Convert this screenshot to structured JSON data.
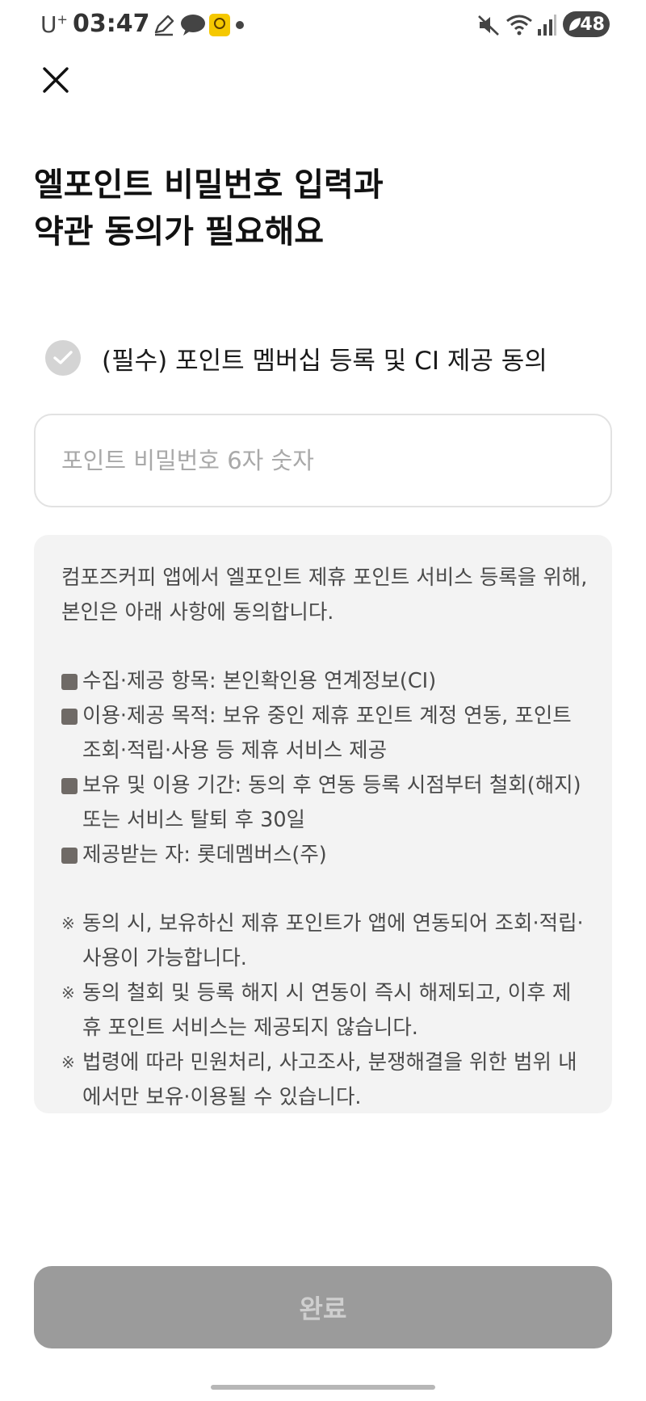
{
  "status_bar": {
    "carrier": "U",
    "carrier_sup": "+",
    "time": "03:47",
    "battery": "48",
    "icons": [
      "pen-icon",
      "chat-bubble-icon",
      "app-badge-icon",
      "notification-dot-icon",
      "mute-icon",
      "wifi-icon",
      "signal-icon",
      "battery-icon"
    ]
  },
  "header": {
    "close_icon": "close-icon",
    "title_line1": "엘포인트 비밀번호 입력과",
    "title_line2": "약관 동의가 필요해요"
  },
  "consent": {
    "label": "(필수) 포인트 멤버십 등록 및 CI 제공 동의",
    "icon": "check-circle-icon"
  },
  "password": {
    "value": "",
    "placeholder": "포인트 비밀번호 6자 숫자"
  },
  "terms": {
    "intro": "컴포즈커피 앱에서 엘포인트 제휴 포인트 서비스 등록을 위해, 본인은 아래 사항에 동의합니다.",
    "items": [
      "수집·제공 항목: 본인확인용 연계정보(CI)",
      "이용·제공 목적: 보유 중인 제휴 포인트 계정 연동, 포인트 조회·적립·사용 등 제휴 서비스 제공",
      "보유 및 이용 기간: 동의 후 연동 등록 시점부터 철회(해지) 또는 서비스 탈퇴 후 30일",
      "제공받는 자: 롯데멤버스(주)"
    ],
    "note_mark": "※",
    "notes": [
      "동의 시, 보유하신 제휴 포인트가 앱에 연동되어 조회·적립·사용이 가능합니다.",
      "동의 철회 및 등록 해지 시 연동이 즉시 해제되고, 이후 제휴 포인트 서비스는 제공되지 않습니다.",
      "법령에 따라 민원처리, 사고조사, 분쟁해결을 위한 범위 내에서만 보유·이용될 수 있습니다."
    ]
  },
  "footer": {
    "complete_label": "완료"
  },
  "colors": {
    "button_disabled": "#9b9b9b",
    "terms_bg": "#f3f3f3",
    "check_inactive": "#d4d4d4"
  }
}
